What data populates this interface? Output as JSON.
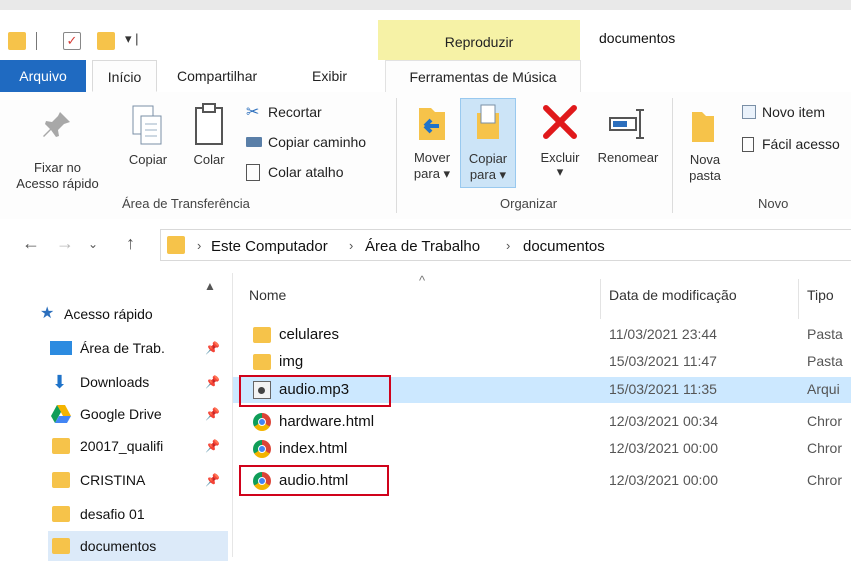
{
  "window": {
    "title": "documentos",
    "context_tab": "Reproduzir"
  },
  "tabs": [
    "Arquivo",
    "Início",
    "Compartilhar",
    "Exibir",
    "Ferramentas de Música"
  ],
  "ribbon": {
    "pin_label": "Fixar no",
    "pin_label2": "Acesso rápido",
    "copy": "Copiar",
    "paste": "Colar",
    "cut": "Recortar",
    "copy_path": "Copiar caminho",
    "paste_shortcut": "Colar atalho",
    "move_to": "Mover",
    "move_to2": "para ▾",
    "copy_to": "Copiar",
    "copy_to2": "para ▾",
    "delete": "Excluir",
    "rename": "Renomear",
    "new_folder": "Nova",
    "new_folder2": "pasta",
    "new_item": "Novo item",
    "easy_access": "Fácil acesso",
    "group_clipboard": "Área de Transferência",
    "group_organize": "Organizar",
    "group_new": "Novo"
  },
  "address": {
    "crumbs": [
      "Este Computador",
      "Área de Trabalho",
      "documentos"
    ]
  },
  "sidebar": {
    "items": [
      {
        "label": "Acesso rápido"
      },
      {
        "label": "Área de Trab."
      },
      {
        "label": "Downloads"
      },
      {
        "label": "Google Drive"
      },
      {
        "label": "20017_qualifi"
      },
      {
        "label": "CRISTINA"
      },
      {
        "label": "desafio 01"
      },
      {
        "label": "documentos"
      }
    ]
  },
  "columns": {
    "name": "Nome",
    "date": "Data de modificação",
    "type": "Tipo"
  },
  "files": [
    {
      "name": "celulares",
      "date": "11/03/2021 23:44",
      "type": "Pasta"
    },
    {
      "name": "img",
      "date": "15/03/2021 11:47",
      "type": "Pasta"
    },
    {
      "name": "audio.mp3",
      "date": "15/03/2021 11:35",
      "type": "Arqui"
    },
    {
      "name": "hardware.html",
      "date": "12/03/2021 00:34",
      "type": "Chror"
    },
    {
      "name": "index.html",
      "date": "12/03/2021 00:00",
      "type": "Chror"
    },
    {
      "name": "audio.html",
      "date": "12/03/2021 00:00",
      "type": "Chror"
    }
  ],
  "colors": {
    "accent": "#1f6ac1",
    "selected_row": "#cce8ff",
    "highlight_box": "#d0021b",
    "context_tab_bg": "#f6f2a6",
    "folder": "#f6c34a"
  }
}
